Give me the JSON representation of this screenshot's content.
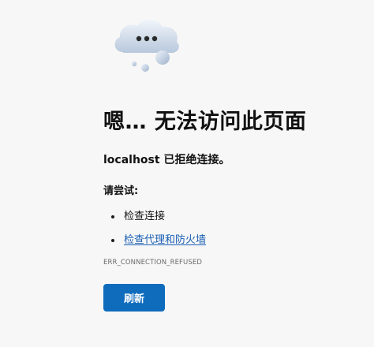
{
  "error_page": {
    "icon": "thinking-cloud-icon",
    "title": "嗯… 无法访问此页面",
    "message": "localhost 已拒绝连接。",
    "try_label": "请尝试:",
    "suggestions": [
      {
        "label": "检查连接",
        "is_link": false
      },
      {
        "label": "检查代理和防火墙",
        "is_link": true
      }
    ],
    "error_code": "ERR_CONNECTION_REFUSED",
    "refresh_label": "刷新"
  },
  "colors": {
    "background": "#f7f7f7",
    "text": "#111111",
    "link": "#1a5fb4",
    "button": "#0f6cbd",
    "button_text": "#ffffff",
    "muted": "#6b6b6b"
  }
}
